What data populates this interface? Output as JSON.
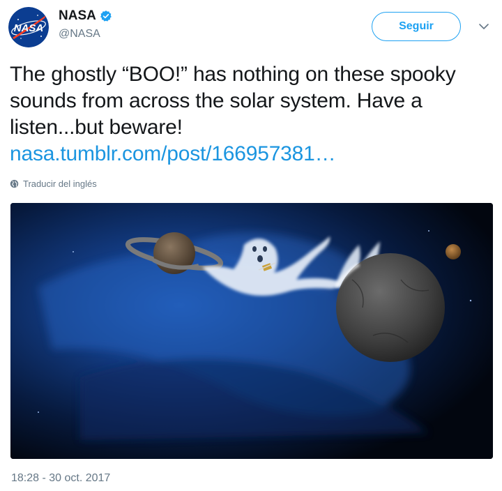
{
  "account": {
    "display_name": "NASA",
    "handle": "@NASA",
    "avatar_text": "NASA",
    "verified_icon": "verified-badge-icon"
  },
  "actions": {
    "follow_label": "Seguir",
    "more_icon": "chevron-down-icon"
  },
  "tweet": {
    "text": "The ghostly “BOO!” has nothing on these spooky sounds from across the solar system. Have a listen...but beware! ",
    "link_text": "nasa.tumblr.com/post/166957381…",
    "translate_label": "Traducir del inglés",
    "translate_icon": "globe-icon",
    "media_description_icon": "image",
    "timestamp": "18:28 - 30 oct. 2017"
  },
  "colors": {
    "accent": "#1da1f2",
    "link": "#1b95e0",
    "secondary_text": "#657786"
  }
}
